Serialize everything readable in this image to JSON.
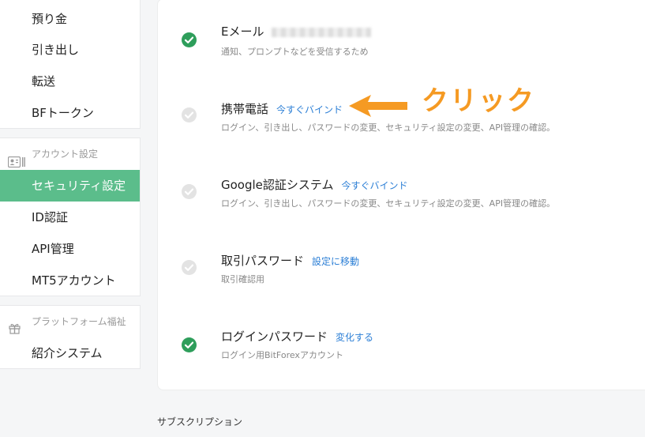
{
  "sidebar": {
    "group1": [
      {
        "label": "預り金"
      },
      {
        "label": "引き出し"
      },
      {
        "label": "転送"
      },
      {
        "label": "BFトークン"
      }
    ],
    "account_section": {
      "header": "アカウント設定",
      "items": [
        {
          "label": "セキュリティ設定",
          "active": true
        },
        {
          "label": "ID認証"
        },
        {
          "label": "API管理"
        },
        {
          "label": "MT5アカウント"
        }
      ]
    },
    "platform_section": {
      "header": "プラットフォーム福祉",
      "items": [
        {
          "label": "紹介システム"
        }
      ]
    }
  },
  "security": {
    "rows": [
      {
        "title": "Eメール",
        "link": "",
        "desc": "通知、プロンプトなどを受信するため",
        "status": "verified"
      },
      {
        "title": "携帯電話",
        "link": "今すぐバインド",
        "desc": "ログイン、引き出し、パスワードの変更、セキュリティ設定の変更、API管理の確認。",
        "status": "unset"
      },
      {
        "title": "Google認証システム",
        "link": "今すぐバインド",
        "desc": "ログイン、引き出し、パスワードの変更、セキュリティ設定の変更、API管理の確認。",
        "status": "unset"
      },
      {
        "title": "取引パスワード",
        "link": "設定に移動",
        "desc": "取引確認用",
        "status": "unset"
      },
      {
        "title": "ログインパスワード",
        "link": "変化する",
        "desc": "ログイン用BitForexアカウント",
        "status": "verified"
      }
    ]
  },
  "annotation": {
    "text": "クリック"
  },
  "footer": {
    "label": "サブスクリプション"
  },
  "colors": {
    "accent_green": "#5bbd8b",
    "verified_green": "#2e9e5b",
    "unset_gray": "#e3e3e3",
    "link_blue": "#2c7fd6",
    "annotation_orange": "#f59a23"
  }
}
